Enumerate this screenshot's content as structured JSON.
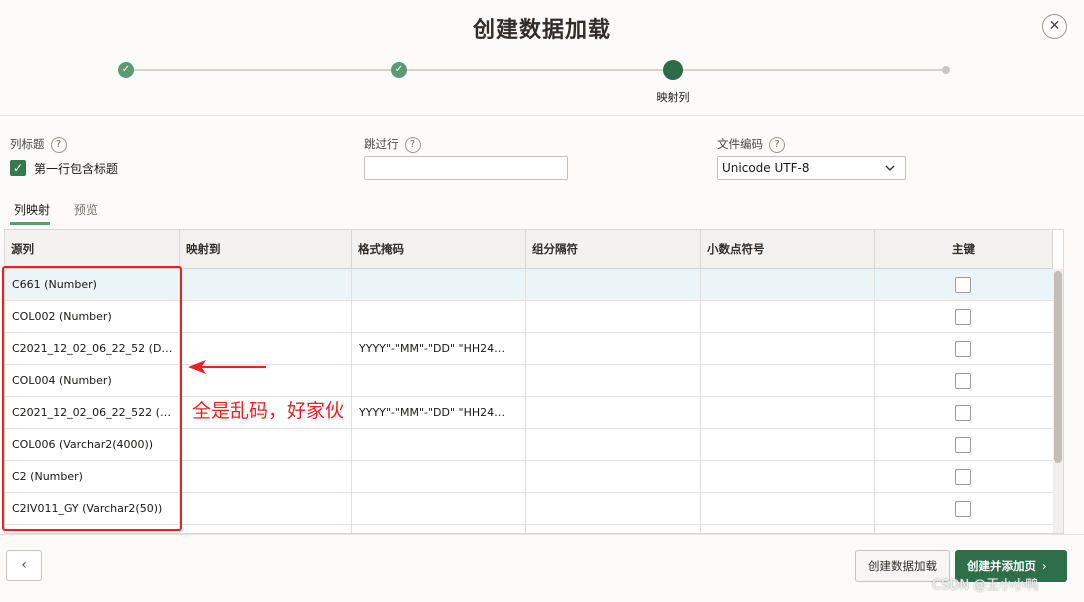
{
  "dialog": {
    "title": "创建数据加载",
    "close_glyph": "✕"
  },
  "progress": {
    "steps": [
      {
        "state": "done",
        "glyph": "✓"
      },
      {
        "state": "done",
        "glyph": "✓"
      },
      {
        "state": "current",
        "label": "映射列"
      },
      {
        "state": "future"
      }
    ]
  },
  "settings": {
    "column_header_label": "列标题",
    "first_row_checkbox_label": "第一行包含标题",
    "first_row_checked": true,
    "skip_rows_label": "跳过行",
    "skip_rows_value": "",
    "encoding_label": "文件编码",
    "encoding_value": "Unicode UTF-8",
    "help_glyph": "?"
  },
  "tabs": [
    {
      "label": "列映射",
      "active": true
    },
    {
      "label": "预览",
      "active": false
    }
  ],
  "grid": {
    "columns": [
      "源列",
      "映射到",
      "格式掩码",
      "组分隔符",
      "小数点符号",
      "主键"
    ],
    "rows": [
      {
        "source": "C661 (Number)",
        "mask": "",
        "primary_key": false,
        "selected": true
      },
      {
        "source": "COL002 (Number)",
        "mask": "",
        "primary_key": false,
        "selected": false
      },
      {
        "source": "C2021_12_02_06_22_52 (D…",
        "mask": "YYYY\"-\"MM\"-\"DD\" \"HH24…",
        "primary_key": false,
        "selected": false
      },
      {
        "source": "COL004 (Number)",
        "mask": "",
        "primary_key": false,
        "selected": false
      },
      {
        "source": "C2021_12_02_06_22_522 (…",
        "mask": "YYYY\"-\"MM\"-\"DD\" \"HH24…",
        "primary_key": false,
        "selected": false
      },
      {
        "source": "COL006 (Varchar2(4000))",
        "mask": "",
        "primary_key": false,
        "selected": false
      },
      {
        "source": "C2 (Number)",
        "mask": "",
        "primary_key": false,
        "selected": false
      },
      {
        "source": "C2IV011_GY (Varchar2(50))",
        "mask": "",
        "primary_key": false,
        "selected": false
      }
    ]
  },
  "annotation": {
    "text": "全是乱码，好家伙",
    "color": "#e82222"
  },
  "footer": {
    "prev_glyph": "‹",
    "create_label": "创建数据加载",
    "create_and_add_label": "创建并添加页",
    "next_glyph": "›"
  },
  "watermark": "CSDN @王小小鸭"
}
